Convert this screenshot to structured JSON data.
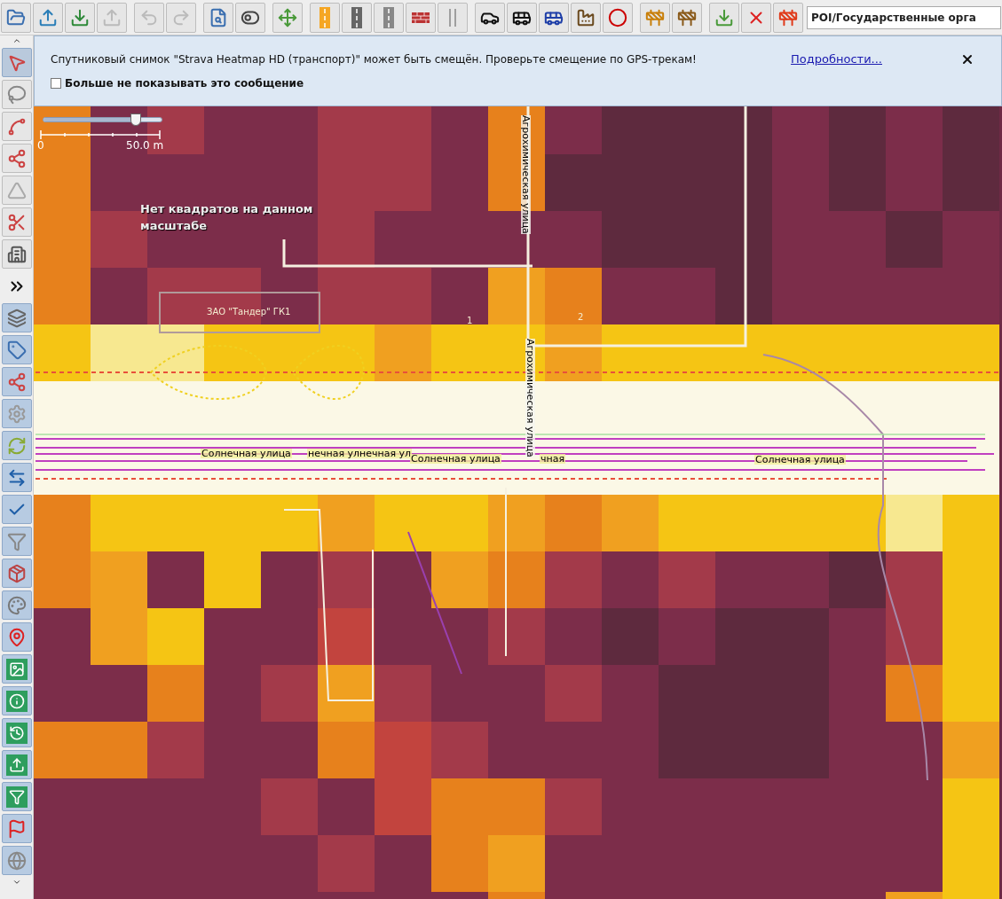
{
  "toolbar": {
    "preset_search": {
      "value": "POI/Государственные орга"
    }
  },
  "notification": {
    "message": "Спутниковый снимок \"Strava Heatmap HD (транспорт)\" может быть смещён. Проверьте смещение по GPS-трекам!",
    "link": "Подробности...",
    "checkbox": {
      "label": "Больше не показывать это сообщение",
      "checked": false
    }
  },
  "map": {
    "opacity_slider": {
      "level": 0.78
    },
    "scale": {
      "start": "0",
      "end": "50.0 m"
    },
    "no_tiles_message": "Нет квадратов на данном масштабе",
    "labels": [
      {
        "kind": "building",
        "text": "ЗАО \"Тандер\" ГК1"
      },
      {
        "kind": "building",
        "text": "1"
      },
      {
        "kind": "building",
        "text": "2"
      },
      {
        "kind": "vertical",
        "text": "Агрохимическая улица"
      },
      {
        "kind": "vertical",
        "text": "Агрохимическая улица"
      },
      {
        "kind": "street",
        "text": "Солнечная улица"
      },
      {
        "kind": "street",
        "text": "нечная улнечная ул"
      },
      {
        "kind": "street",
        "text": "Солнечная улица"
      },
      {
        "kind": "street",
        "text": "чная"
      },
      {
        "kind": "street",
        "text": "Солнечная улица"
      }
    ]
  }
}
